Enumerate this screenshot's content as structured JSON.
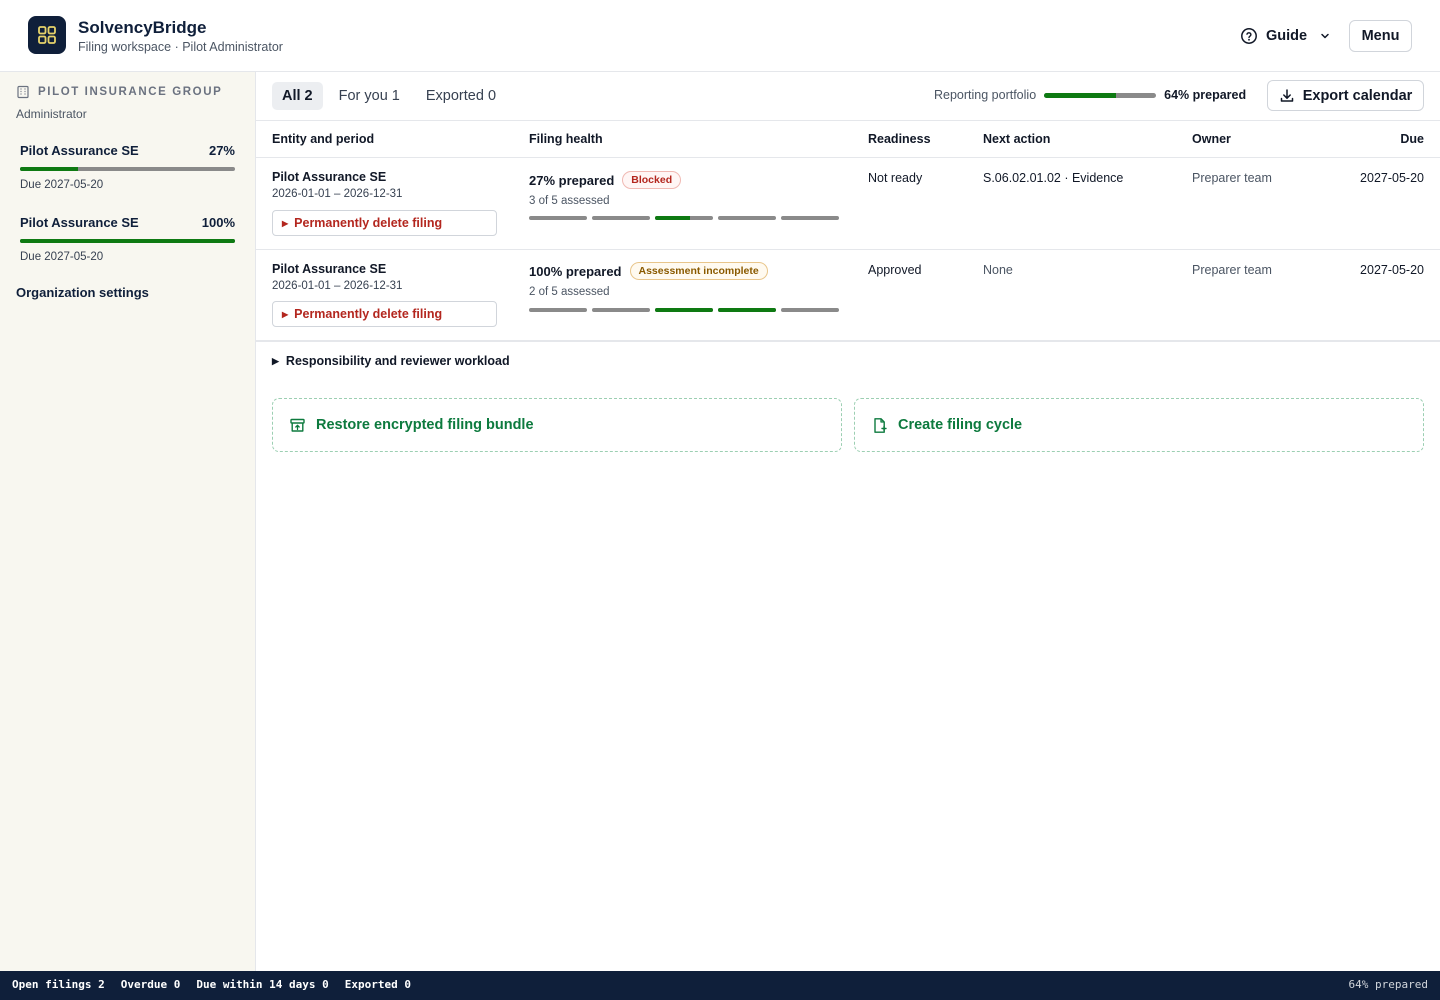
{
  "app": {
    "name": "SolvencyBridge",
    "subtitle": "Filing workspace · Pilot Administrator",
    "guide_label": "Guide",
    "menu_label": "Menu"
  },
  "sidebar": {
    "org_name": "PILOT INSURANCE GROUP",
    "role": "Administrator",
    "items": [
      {
        "name": "Pilot Assurance SE",
        "pct": "27%",
        "progress": 0.27,
        "due": "Due 2027-05-20"
      },
      {
        "name": "Pilot Assurance SE",
        "pct": "100%",
        "progress": 1.0,
        "due": "Due 2027-05-20"
      }
    ],
    "org_settings": "Organization settings"
  },
  "tabs": [
    {
      "label": "All 2",
      "active": true
    },
    {
      "label": "For you 1",
      "active": false
    },
    {
      "label": "Exported 0",
      "active": false
    }
  ],
  "portfolio": {
    "label": "Reporting portfolio",
    "progress": 0.64,
    "text": "64% prepared"
  },
  "export_label": "Export calendar",
  "table": {
    "headers": {
      "entity": "Entity and period",
      "health": "Filing health",
      "readiness": "Readiness",
      "next_action": "Next action",
      "owner": "Owner",
      "due": "Due"
    },
    "rows": [
      {
        "entity": "Pilot Assurance SE",
        "period": "2026-01-01 – 2026-12-31",
        "delete_label": "Permanently delete filing",
        "health_pct": "27% prepared",
        "badge": "Blocked",
        "assessed": "3 of 5 assessed",
        "segments": [
          0,
          0,
          0.6,
          0,
          0
        ],
        "readiness": "Not ready",
        "next_action": "S.06.02.01.02 · Evidence",
        "owner": "Preparer team",
        "due": "2027-05-20"
      },
      {
        "entity": "Pilot Assurance SE",
        "period": "2026-01-01 – 2026-12-31",
        "delete_label": "Permanently delete filing",
        "health_pct": "100% prepared",
        "badge": "Assessment incomplete",
        "assessed": "2 of 5 assessed",
        "segments": [
          0,
          0,
          1,
          1,
          0
        ],
        "readiness": "Approved",
        "next_action": "None",
        "owner": "Preparer team",
        "due": "2027-05-20"
      }
    ]
  },
  "responsibility_label": "Responsibility and reviewer workload",
  "actions": {
    "restore": "Restore encrypted filing bundle",
    "create": "Create filing cycle"
  },
  "statusbar": {
    "open": "Open filings 2",
    "overdue": "Overdue 0",
    "due_soon": "Due within 14 days 0",
    "exported": "Exported 0",
    "right": "64% prepared"
  },
  "colors": {
    "brand": "#0f1f3a",
    "progress_fill": "#0e7a12",
    "danger": "#b3261e",
    "action": "#0d7a3e"
  }
}
